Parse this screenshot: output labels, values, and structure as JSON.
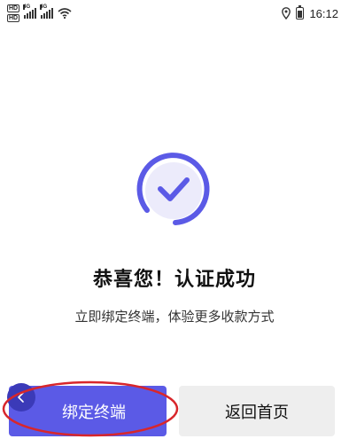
{
  "status_bar": {
    "sim1_badge": "HD",
    "sim2_badge": "HD",
    "sim1_network": "4G",
    "sim2_network": "4G",
    "time": "16:12",
    "icons": [
      "wifi-icon",
      "location-icon",
      "battery-icon"
    ]
  },
  "result": {
    "title": "恭喜您！认证成功",
    "subtitle": "立即绑定终端，体验更多收款方式",
    "icon": "checkmark-circle-icon"
  },
  "actions": {
    "bind_label": "绑定终端",
    "home_label": "返回首页"
  },
  "colors": {
    "accent": "#5b5ae6",
    "secondary_button": "#eeeeee",
    "annotation": "#d8262b"
  }
}
